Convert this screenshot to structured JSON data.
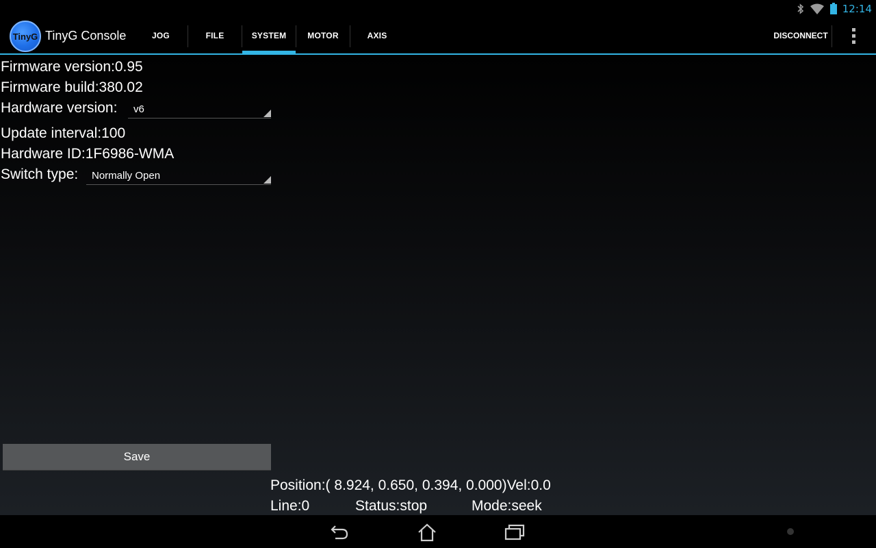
{
  "status_bar": {
    "time": "12:14",
    "icons": [
      "bluetooth-icon",
      "wifi-icon",
      "battery-icon"
    ]
  },
  "action_bar": {
    "logo_text": "TinyG",
    "title": "TinyG Console",
    "tabs": [
      {
        "label": "JOG",
        "selected": false
      },
      {
        "label": "FILE",
        "selected": false
      },
      {
        "label": "SYSTEM",
        "selected": true
      },
      {
        "label": "MOTOR",
        "selected": false
      },
      {
        "label": "AXIS",
        "selected": false
      }
    ],
    "disconnect_label": "DISCONNECT",
    "accent_color": "#33b5e5"
  },
  "system": {
    "firmware_version": "Firmware version:0.95",
    "firmware_build": "Firmware build:380.02",
    "hardware_version_label": "Hardware version:",
    "hardware_version_value": "v6",
    "update_interval": "Update interval:100",
    "hardware_id": "Hardware ID:1F6986-WMA",
    "switch_type_label": "Switch type:",
    "switch_type_value": "Normally Open",
    "save_label": "Save"
  },
  "machine_status": {
    "position": "Position:( 8.924, 0.650, 0.394, 0.000)Vel:0.0",
    "line": "Line:0",
    "status": "Status:stop",
    "mode": "Mode:seek"
  },
  "nav_bar": {
    "buttons": [
      "back-icon",
      "home-icon",
      "recent-apps-icon"
    ]
  }
}
